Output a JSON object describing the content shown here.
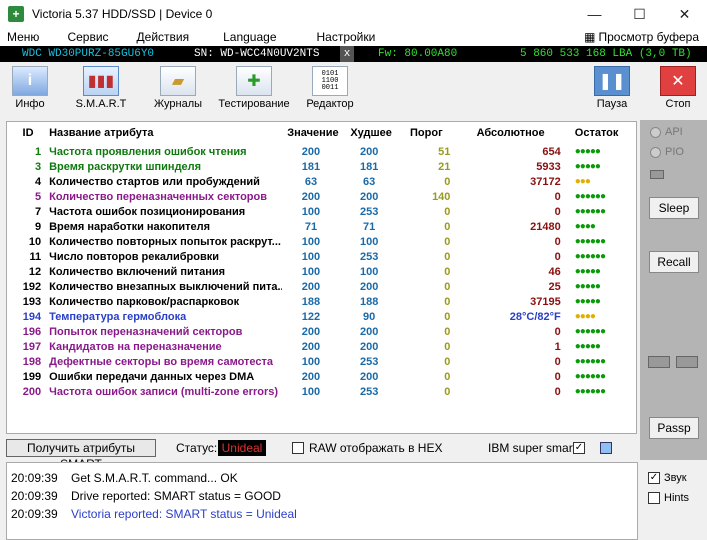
{
  "window": {
    "title": "Victoria 5.37 HDD/SSD | Device 0",
    "app_icon": "+"
  },
  "menu": {
    "items": [
      "Меню",
      "Сервис",
      "Действия",
      "Language",
      "Настройки"
    ],
    "right": "Просмотр буфера"
  },
  "drive": {
    "model": "WDC WD30PURZ-85GU6Y0",
    "serial": "SN: WD-WCC4N0UV2NTS",
    "close": "x",
    "firmware": "Fw: 80.00A80",
    "capacity": "5 860 533 168 LBA (3,0 TB)"
  },
  "toolbar": {
    "info": "Инфо",
    "smart": "S.M.A.R.T",
    "logs": "Журналы",
    "test": "Тестирование",
    "editor": "Редактор",
    "pause": "Пауза",
    "stop": "Стоп"
  },
  "table": {
    "headers": {
      "id": "ID",
      "name": "Название атрибута",
      "value": "Значение",
      "worst": "Худшее",
      "threshold": "Порог",
      "absolute": "Абсолютное",
      "rest": "Остаток"
    },
    "rows": [
      {
        "id": "1",
        "name": "Частота проявления ошибок чтения",
        "value": "200",
        "worst": "200",
        "thr": "51",
        "abs": "654",
        "rest": "●●●●●",
        "cls": "g",
        "dots": "g"
      },
      {
        "id": "3",
        "name": "Время раскрутки шпинделя",
        "value": "181",
        "worst": "181",
        "thr": "21",
        "abs": "5933",
        "rest": "●●●●●",
        "cls": "g",
        "dots": "g"
      },
      {
        "id": "4",
        "name": "Количество стартов или пробуждений",
        "value": "63",
        "worst": "63",
        "thr": "0",
        "abs": "37172",
        "rest": "●●●",
        "cls": "b",
        "dots": "y"
      },
      {
        "id": "5",
        "name": "Количество переназначенных секторов",
        "value": "200",
        "worst": "200",
        "thr": "140",
        "abs": "0",
        "rest": "●●●●●●",
        "cls": "v",
        "dots": "g"
      },
      {
        "id": "7",
        "name": "Частота ошибок позиционирования",
        "value": "100",
        "worst": "253",
        "thr": "0",
        "abs": "0",
        "rest": "●●●●●●",
        "cls": "b",
        "dots": "g"
      },
      {
        "id": "9",
        "name": "Время наработки накопителя",
        "value": "71",
        "worst": "71",
        "thr": "0",
        "abs": "21480",
        "rest": "●●●●",
        "cls": "b",
        "dots": "g"
      },
      {
        "id": "10",
        "name": "Количество повторных попыток раскрут...",
        "value": "100",
        "worst": "100",
        "thr": "0",
        "abs": "0",
        "rest": "●●●●●●",
        "cls": "b",
        "dots": "g"
      },
      {
        "id": "11",
        "name": "Число повторов рекалибровки",
        "value": "100",
        "worst": "253",
        "thr": "0",
        "abs": "0",
        "rest": "●●●●●●",
        "cls": "b",
        "dots": "g"
      },
      {
        "id": "12",
        "name": "Количество включений питания",
        "value": "100",
        "worst": "100",
        "thr": "0",
        "abs": "46",
        "rest": "●●●●●",
        "cls": "b",
        "dots": "g"
      },
      {
        "id": "192",
        "name": "Количество внезапных выключений пита...",
        "value": "200",
        "worst": "200",
        "thr": "0",
        "abs": "25",
        "rest": "●●●●●",
        "cls": "b",
        "dots": "g"
      },
      {
        "id": "193",
        "name": "Количество парковок/распарковок",
        "value": "188",
        "worst": "188",
        "thr": "0",
        "abs": "37195",
        "rest": "●●●●●",
        "cls": "b",
        "dots": "g"
      },
      {
        "id": "194",
        "name": "Температура гермоблока",
        "value": "122",
        "worst": "90",
        "thr": "0",
        "abs": "28°C/82°F",
        "rest": "●●●●",
        "cls": "bl",
        "dots": "y"
      },
      {
        "id": "196",
        "name": "Попыток переназначений секторов",
        "value": "200",
        "worst": "200",
        "thr": "0",
        "abs": "0",
        "rest": "●●●●●●",
        "cls": "v",
        "dots": "g"
      },
      {
        "id": "197",
        "name": "Кандидатов на переназначение",
        "value": "200",
        "worst": "200",
        "thr": "0",
        "abs": "1",
        "rest": "●●●●●",
        "cls": "v",
        "dots": "g"
      },
      {
        "id": "198",
        "name": "Дефектные секторы во время самотеста",
        "value": "100",
        "worst": "253",
        "thr": "0",
        "abs": "0",
        "rest": "●●●●●●",
        "cls": "v",
        "dots": "g"
      },
      {
        "id": "199",
        "name": "Ошибки передачи данных через DMA",
        "value": "200",
        "worst": "200",
        "thr": "0",
        "abs": "0",
        "rest": "●●●●●●",
        "cls": "b",
        "dots": "g"
      },
      {
        "id": "200",
        "name": "Частота ошибок записи (multi-zone errors)",
        "value": "100",
        "worst": "253",
        "thr": "0",
        "abs": "0",
        "rest": "●●●●●●",
        "cls": "v",
        "dots": "g"
      }
    ]
  },
  "side": {
    "api": "API",
    "pio": "PIO",
    "sleep": "Sleep",
    "recall": "Recall",
    "passp": "Passp"
  },
  "status": {
    "get_button": "Получить атрибуты SMART",
    "status_label": "Статус:",
    "status_value": "Unideal",
    "raw_hex": "RAW отображать в HEX",
    "ibm": "IBM super smart:",
    "ibm_check": "✓"
  },
  "log": [
    {
      "time": "20:09:39",
      "msg": "Get S.M.A.R.T. command... OK",
      "color": "#000000"
    },
    {
      "time": "20:09:39",
      "msg": "Drive reported: SMART status = GOOD",
      "color": "#000000"
    },
    {
      "time": "20:09:39",
      "msg": "Victoria reported: SMART status = Unideal",
      "color": "#2a3fc8"
    }
  ],
  "options": {
    "sound": "Звук",
    "sound_check": "✓",
    "hints": "Hints"
  },
  "colors": {
    "accent_green": "#0f7a0f",
    "status_red": "#cc0000",
    "infobar_bg": "#000000"
  }
}
